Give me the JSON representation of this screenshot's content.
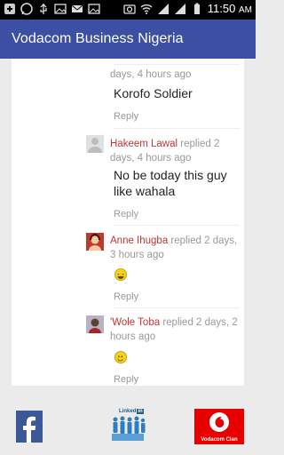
{
  "status_bar": {
    "time": "11:50",
    "am_pm": "AM",
    "icons": [
      "add-icon",
      "whatsapp-icon",
      "usb-icon",
      "image-icon",
      "email-icon",
      "image-icon",
      "camera-icon",
      "wifi-icon",
      "signal-icon",
      "signal-icon",
      "battery-icon"
    ]
  },
  "app_bar": {
    "title": "Vodacom Business Nigeria"
  },
  "replies": [
    {
      "meta_tail": "days, 4 hours ago",
      "body": "Korofo Soldier",
      "reply_label": "Reply"
    },
    {
      "author": "Hakeem Lawal",
      "meta": " replied 2 days, 4 hours ago",
      "body": "No be today this guy like wahala",
      "reply_label": "Reply"
    },
    {
      "author": "Anne Ihugba",
      "meta": " replied 2 days, 3 hours ago",
      "emoji": "laughing-face-icon",
      "reply_label": "Reply"
    },
    {
      "author": "'Wole Toba",
      "meta": " replied 2 days, 2 hours ago",
      "emoji": "smiley-face-icon",
      "reply_label": "Reply"
    }
  ],
  "bottom_nav": {
    "facebook": {
      "icon": "facebook-icon"
    },
    "linkedin": {
      "label": "Linked",
      "badge": "in"
    },
    "vodacom_clan": {
      "label": "Vodacom Clan"
    }
  },
  "colors": {
    "app_bar": "#3c4fa3",
    "author": "#c43535",
    "facebook": "#3b5998",
    "vodacom": "#e60000"
  }
}
